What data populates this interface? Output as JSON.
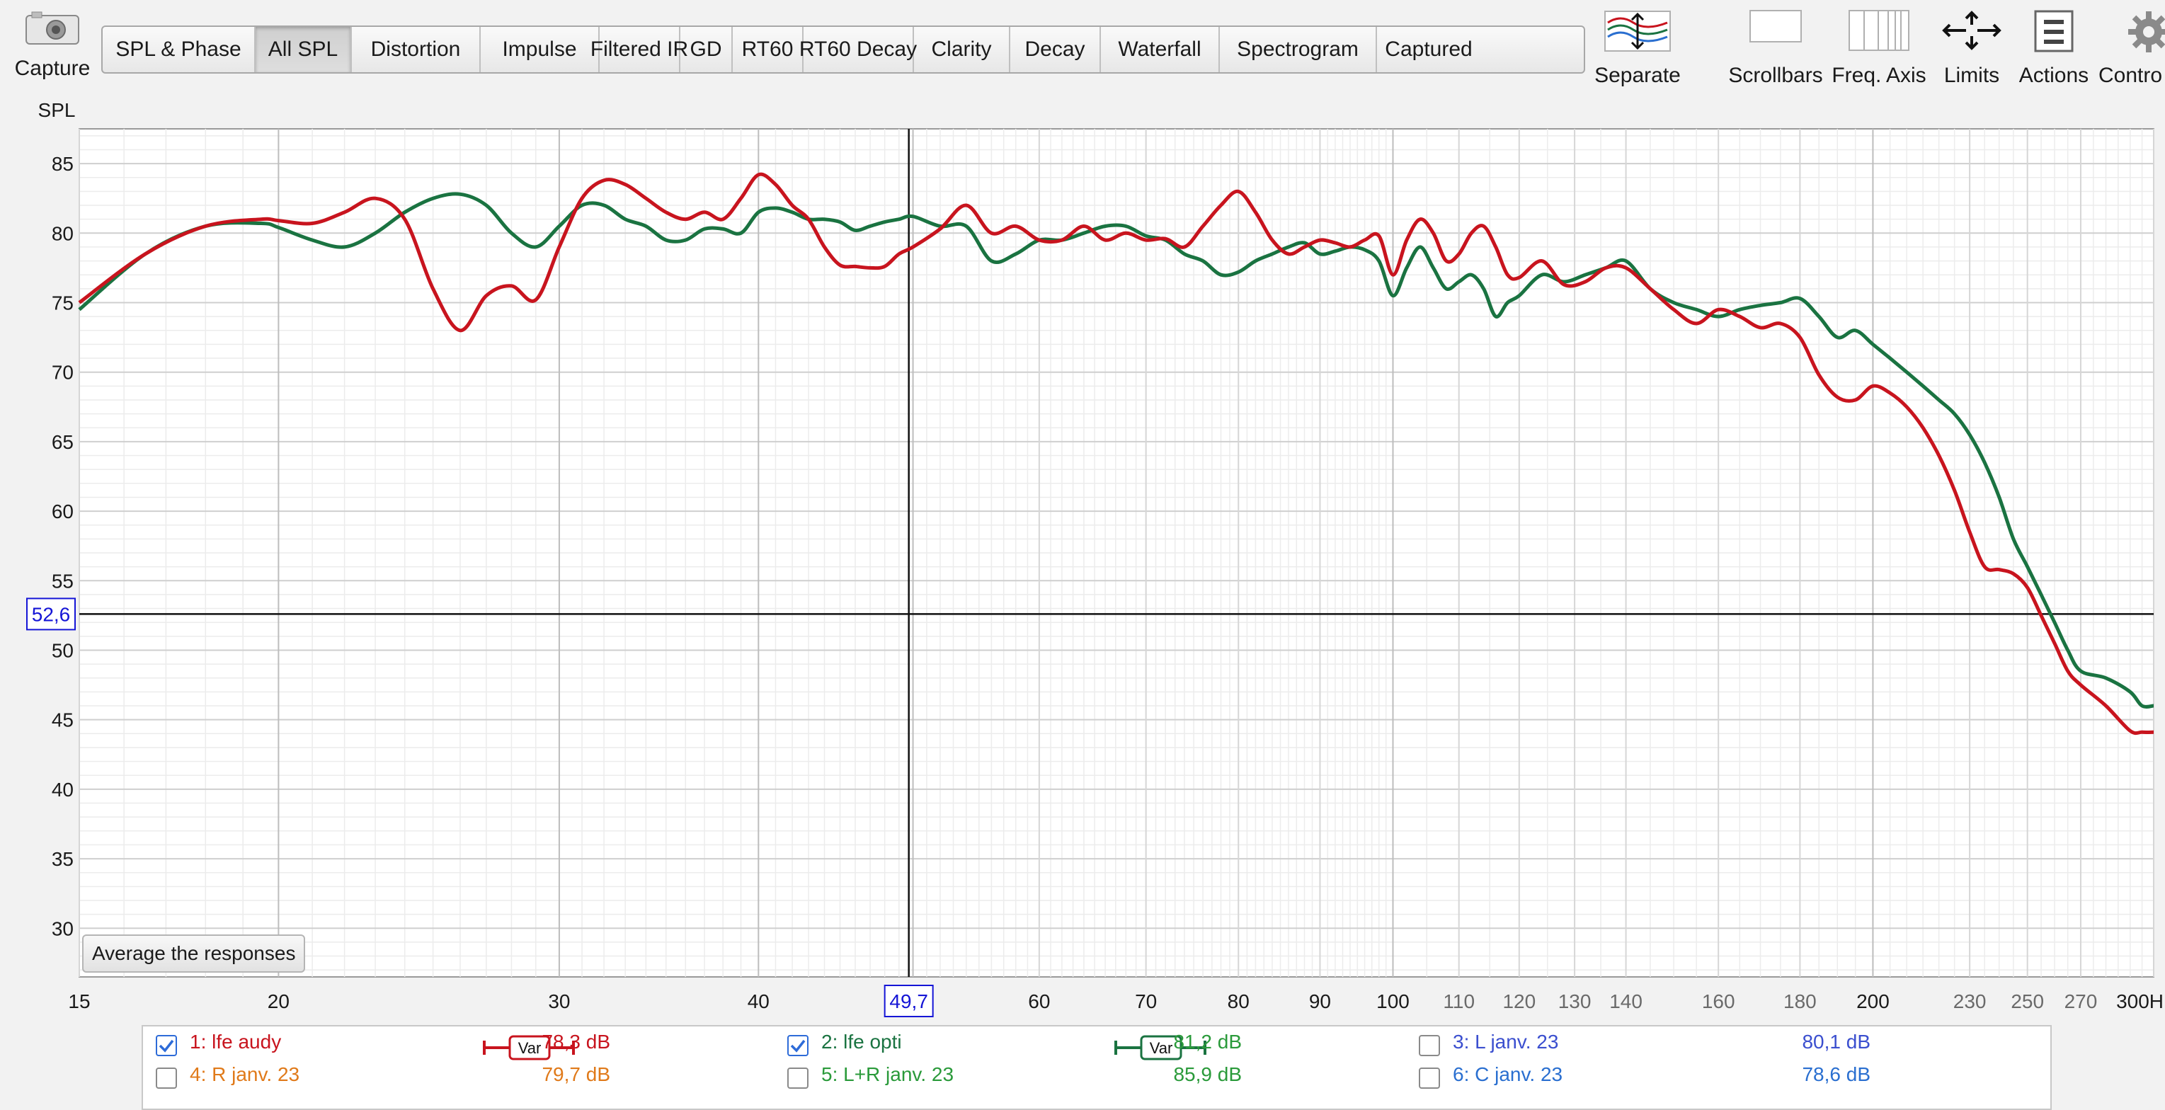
{
  "toolbar": {
    "capture_label": "Capture",
    "tabs": [
      {
        "label": "SPL & Phase",
        "active": false
      },
      {
        "label": "All SPL",
        "active": true
      },
      {
        "label": "Distortion",
        "active": false
      },
      {
        "label": "Impulse",
        "active": false
      },
      {
        "label": "Filtered IR",
        "active": false
      },
      {
        "label": "GD",
        "active": false
      },
      {
        "label": "RT60",
        "active": false
      },
      {
        "label": "RT60 Decay",
        "active": false
      },
      {
        "label": "Clarity",
        "active": false
      },
      {
        "label": "Decay",
        "active": false
      },
      {
        "label": "Waterfall",
        "active": false
      },
      {
        "label": "Spectrogram",
        "active": false
      },
      {
        "label": "Captured",
        "active": false
      }
    ],
    "right_buttons": {
      "separate": "Separate",
      "scrollbars": "Scrollbars",
      "freq_axis": "Freq. Axis",
      "limits": "Limits",
      "actions": "Actions",
      "controls": "Contro"
    }
  },
  "chart": {
    "ylabel": "SPL",
    "cursor_y_label": "52,6",
    "cursor_x_label": "49,7",
    "avg_button": "Average the responses",
    "colors": {
      "series1": "#c8141e",
      "series2": "#1a7341",
      "cursor": "#1515d6"
    }
  },
  "chart_data": {
    "type": "line",
    "xscale": "log",
    "xlim": [
      15,
      300
    ],
    "ylim": [
      26.5,
      87.5
    ],
    "yticks": [
      85,
      80,
      75,
      70,
      65,
      60,
      55,
      50,
      45,
      40,
      35,
      30
    ],
    "xticks": [
      15,
      20,
      30,
      40,
      50,
      60,
      70,
      80,
      90,
      100,
      110,
      120,
      130,
      140,
      160,
      180,
      200,
      230,
      250,
      270,
      300
    ],
    "xtick_labels": [
      "15",
      "20",
      "30",
      "40",
      "",
      "60",
      "70",
      "80",
      "90",
      "100",
      "110",
      "120",
      "130",
      "140",
      "160",
      "180",
      "200",
      "230",
      "250",
      "270",
      "300H"
    ],
    "cursor": {
      "x": 49.7,
      "y": 52.6
    },
    "grid": true,
    "series": [
      {
        "name": "1: lfe audy",
        "color": "#c8141e",
        "x": [
          15,
          16.5,
          18,
          19.5,
          20,
          21,
          22,
          23,
          24,
          25,
          26,
          27,
          28,
          29,
          30,
          31,
          32,
          33,
          34,
          35,
          36,
          37,
          38,
          39,
          40,
          41,
          42,
          43,
          44,
          45,
          46,
          47,
          48,
          49,
          50,
          52,
          54,
          56,
          58,
          60,
          62,
          64,
          66,
          68,
          70,
          72,
          74,
          76,
          78,
          80,
          82,
          84,
          86,
          88,
          90,
          92,
          94,
          96,
          98,
          100,
          102,
          104,
          106,
          108,
          110,
          112,
          114,
          116,
          118,
          120,
          124,
          128,
          132,
          136,
          140,
          145,
          150,
          155,
          160,
          165,
          170,
          175,
          180,
          185,
          190,
          195,
          200,
          205,
          210,
          215,
          220,
          225,
          230,
          235,
          240,
          245,
          250,
          255,
          260,
          265,
          270,
          280,
          290,
          295,
          300
        ],
        "y": [
          75,
          78.5,
          80.5,
          81.0,
          80.9,
          80.7,
          81.5,
          82.5,
          81.0,
          76.0,
          73.0,
          75.5,
          76.2,
          75.2,
          79.0,
          82.5,
          83.8,
          83.5,
          82.5,
          81.5,
          81.0,
          81.5,
          81.0,
          82.5,
          84.2,
          83.5,
          82.0,
          81.0,
          79.0,
          77.7,
          77.6,
          77.5,
          77.6,
          78.5,
          79.0,
          80.3,
          82.0,
          80.0,
          80.5,
          79.5,
          79.5,
          80.5,
          79.5,
          80.0,
          79.5,
          79.6,
          79.0,
          80.5,
          82.0,
          83.0,
          81.5,
          79.5,
          78.5,
          79.0,
          79.5,
          79.3,
          79.0,
          79.5,
          79.8,
          77.0,
          79.5,
          81.0,
          80.0,
          78.0,
          78.5,
          80.0,
          80.5,
          79.0,
          77.0,
          76.8,
          78.0,
          76.3,
          76.5,
          77.5,
          77.5,
          76.0,
          74.5,
          73.5,
          74.5,
          74.0,
          73.2,
          73.5,
          72.5,
          69.8,
          68.2,
          68.0,
          69.0,
          68.5,
          67.5,
          66.0,
          64.0,
          61.5,
          58.5,
          56.0,
          55.8,
          55.5,
          54.5,
          52.5,
          50.5,
          48.5,
          47.5,
          46.0,
          44.2,
          44.1,
          44.1
        ]
      },
      {
        "name": "2: lfe opti",
        "color": "#1a7341",
        "x": [
          15,
          16.5,
          18,
          19.5,
          20,
          21,
          22,
          23,
          24,
          25,
          26,
          27,
          28,
          29,
          30,
          31,
          32,
          33,
          34,
          35,
          36,
          37,
          38,
          39,
          40,
          41,
          42,
          43,
          44,
          45,
          46,
          47,
          48,
          49,
          50,
          52,
          54,
          56,
          58,
          60,
          62,
          64,
          66,
          68,
          70,
          72,
          74,
          76,
          78,
          80,
          82,
          84,
          86,
          88,
          90,
          92,
          94,
          96,
          98,
          100,
          102,
          104,
          106,
          108,
          110,
          112,
          114,
          116,
          118,
          120,
          124,
          128,
          132,
          136,
          140,
          145,
          150,
          155,
          160,
          165,
          170,
          175,
          180,
          185,
          190,
          195,
          200,
          205,
          210,
          215,
          220,
          225,
          230,
          235,
          240,
          245,
          250,
          255,
          260,
          265,
          270,
          280,
          290,
          295,
          300
        ],
        "y": [
          74.5,
          78.5,
          80.5,
          80.7,
          80.4,
          79.5,
          79.0,
          80.0,
          81.5,
          82.5,
          82.8,
          82.0,
          80.0,
          79.0,
          80.5,
          82.0,
          82.0,
          81.0,
          80.5,
          79.5,
          79.5,
          80.3,
          80.3,
          80.0,
          81.5,
          81.8,
          81.5,
          81.0,
          81.0,
          80.8,
          80.2,
          80.5,
          80.8,
          81.0,
          81.2,
          80.5,
          80.5,
          78.0,
          78.5,
          79.5,
          79.5,
          80.0,
          80.5,
          80.5,
          79.8,
          79.5,
          78.5,
          78.0,
          77.0,
          77.2,
          78.0,
          78.5,
          79.0,
          79.3,
          78.5,
          78.7,
          79.0,
          78.8,
          78.0,
          75.5,
          77.5,
          79.0,
          77.5,
          76.0,
          76.5,
          77.0,
          76.0,
          74.0,
          75.0,
          75.5,
          77.0,
          76.5,
          77.0,
          77.5,
          78.0,
          76.0,
          75.0,
          74.5,
          74.0,
          74.5,
          74.8,
          75.0,
          75.3,
          74.0,
          72.5,
          73.0,
          72.0,
          71.0,
          70.0,
          69.0,
          68.0,
          67.0,
          65.5,
          63.5,
          61.0,
          58.0,
          56.0,
          54.0,
          52.0,
          50.0,
          48.5,
          48.0,
          47.0,
          46.0,
          46.0
        ]
      }
    ]
  },
  "legend": {
    "items": [
      {
        "checked": true,
        "name": "1: lfe audy",
        "line_label": "Var",
        "value": "78,3 dB",
        "color": "#c8141e",
        "value_color": "#c8141e"
      },
      {
        "checked": true,
        "name": "2: lfe opti",
        "line_label": "Var",
        "value": "81,2 dB",
        "color": "#1a7341",
        "value_color": "#2a9a3a"
      },
      {
        "checked": false,
        "name": "3: L janv. 23",
        "line_label": "",
        "value": "80,1 dB",
        "color": "#3b4fcf",
        "value_color": "#3b4fcf"
      },
      {
        "checked": false,
        "name": "4: R janv. 23",
        "line_label": "",
        "value": "79,7 dB",
        "color": "#e07a1a",
        "value_color": "#e07a1a"
      },
      {
        "checked": false,
        "name": "5: L+R janv. 23",
        "line_label": "",
        "value": "85,9 dB",
        "color": "#2a9a3a",
        "value_color": "#2a9a3a"
      },
      {
        "checked": false,
        "name": "6: C janv. 23",
        "line_label": "",
        "value": "78,6 dB",
        "color": "#2a6fd0",
        "value_color": "#2a6fd0"
      }
    ]
  }
}
